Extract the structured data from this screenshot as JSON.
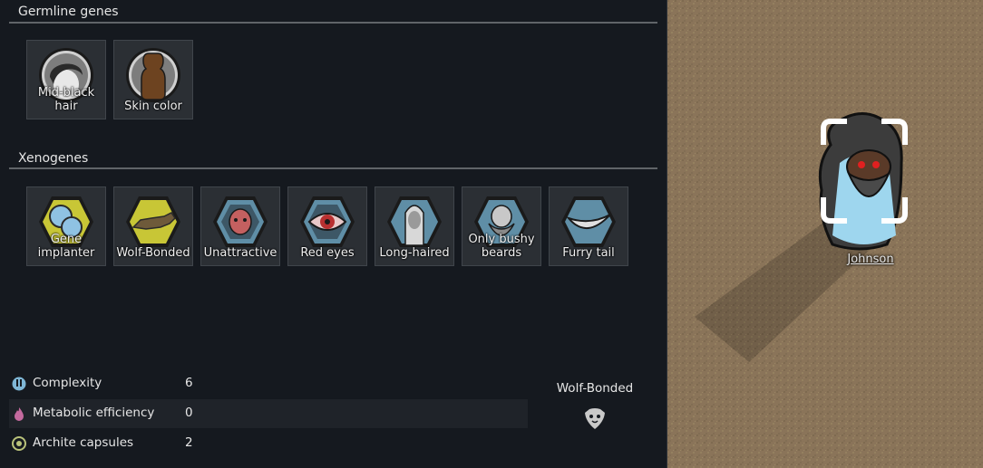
{
  "germline": {
    "title": "Germline genes",
    "genes": [
      {
        "label": "Mid-black hair",
        "icon": "hair-icon"
      },
      {
        "label": "Skin color",
        "icon": "skin-color-icon"
      }
    ]
  },
  "xenogenes": {
    "title": "Xenogenes",
    "genes": [
      {
        "label": "Gene implanter",
        "icon": "gene-implanter-icon"
      },
      {
        "label": "Wolf-Bonded",
        "icon": "wolf-icon"
      },
      {
        "label": "Unattractive",
        "icon": "unattractive-face-icon"
      },
      {
        "label": "Red eyes",
        "icon": "red-eye-icon"
      },
      {
        "label": "Long-haired",
        "icon": "long-hair-icon"
      },
      {
        "label": "Only bushy beards",
        "icon": "bushy-beard-icon"
      },
      {
        "label": "Furry tail",
        "icon": "furry-tail-icon"
      }
    ]
  },
  "stats": [
    {
      "name": "Complexity",
      "value": "6",
      "icon": "complexity-icon",
      "color": "#7fb7d6"
    },
    {
      "name": "Metabolic efficiency",
      "value": "0",
      "icon": "metabolism-icon",
      "color": "#c46a9e"
    },
    {
      "name": "Archite capsules",
      "value": "2",
      "icon": "archite-icon",
      "color": "#b9c27a"
    }
  ],
  "xenotype": {
    "name": "Wolf-Bonded",
    "icon": "xenotype-wolf-icon"
  },
  "pawn": {
    "name": "Johnson"
  },
  "colors": {
    "panel": "#15191f",
    "tile": "#2b2f34",
    "hexBlue": "#5f8ea6",
    "hexYellow": "#c8c636",
    "map": "#8a7459"
  }
}
